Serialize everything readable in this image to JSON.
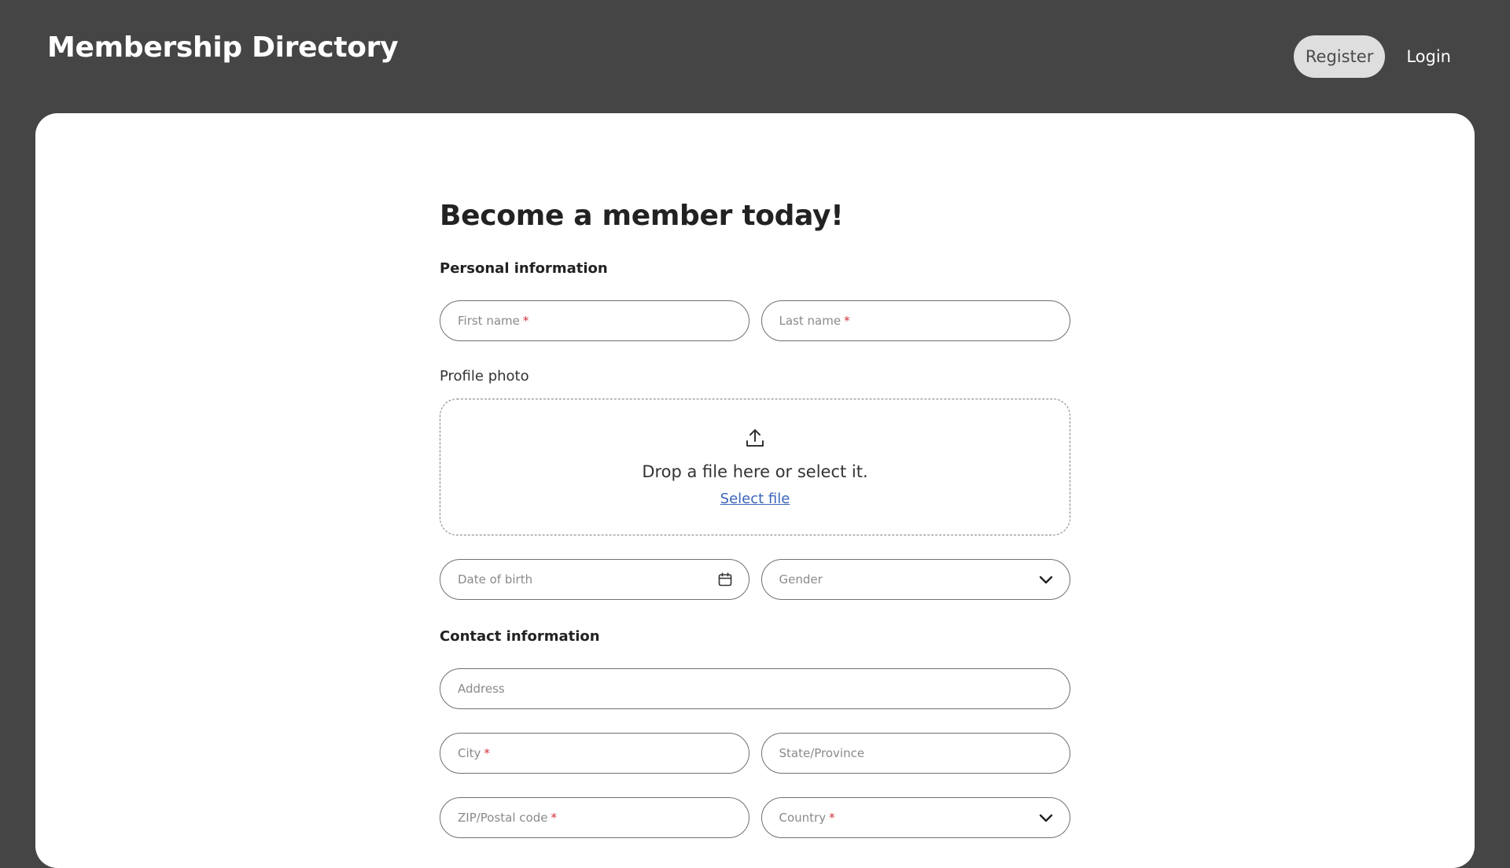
{
  "header": {
    "brand": "Membership Directory",
    "nav": [
      {
        "label": "Register",
        "active": true
      },
      {
        "label": "Login",
        "active": false
      }
    ]
  },
  "form": {
    "title": "Become a member today!",
    "personal_section": "Personal information",
    "first_name_placeholder": "First name",
    "last_name_placeholder": "Last name",
    "required_mark": "*",
    "profile_photo_label": "Profile photo",
    "dropzone_text": "Drop a file here or select it.",
    "select_file_link": "Select file",
    "dob_placeholder": "Date of birth",
    "gender_placeholder": "Gender",
    "contact_section": "Contact information",
    "address_placeholder": "Address",
    "city_placeholder": "City",
    "state_placeholder": "State/Province",
    "zip_placeholder": "ZIP/Postal code",
    "country_placeholder": "Country"
  },
  "icons": {
    "upload": "upload-icon",
    "calendar": "calendar-icon",
    "chevron": "chevron-down-icon"
  },
  "colors": {
    "background": "#454545",
    "card": "#ffffff",
    "required": "#d0303c",
    "link": "#3b64b8",
    "active_nav": "#dedede"
  }
}
